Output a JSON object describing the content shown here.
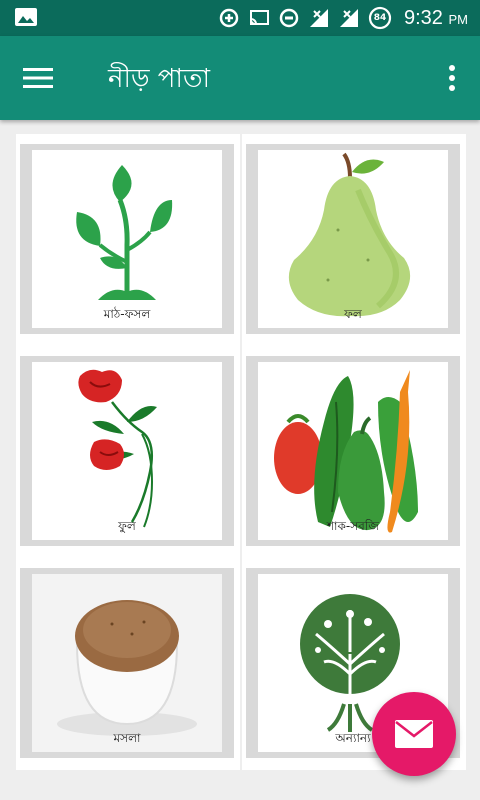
{
  "status_bar": {
    "time": "9:32",
    "ampm": "PM",
    "battery": "84",
    "icons": [
      "gallery-icon",
      "data-saver-icon",
      "cast-icon",
      "do-not-disturb-icon",
      "signal-icon",
      "signal-icon",
      "battery-icon"
    ]
  },
  "app_bar": {
    "title": "নীড় পাতা",
    "menu_icon": "hamburger-icon",
    "more_icon": "more-vert-icon"
  },
  "categories": [
    {
      "label": "মাঠ-ফসল",
      "icon": "plant-icon"
    },
    {
      "label": "ফল",
      "icon": "pear-icon"
    },
    {
      "label": "ফুল",
      "icon": "rose-icon"
    },
    {
      "label": "শাক-সবজি",
      "icon": "vegetables-icon"
    },
    {
      "label": "মসলা",
      "icon": "spice-bowl-icon"
    },
    {
      "label": "অন্যান্য",
      "icon": "tree-icon"
    }
  ],
  "fab": {
    "icon": "mail-icon"
  },
  "colors": {
    "status_bar": "#0b6b5b",
    "app_bar": "#138c77",
    "fab": "#e51968",
    "card_frame": "#d9d9d9"
  }
}
